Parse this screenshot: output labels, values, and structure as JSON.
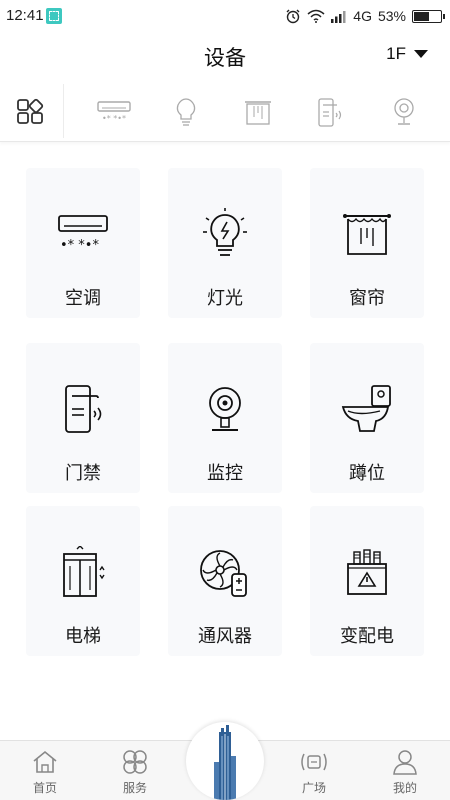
{
  "status_bar": {
    "time": "12:41",
    "network": "4G",
    "battery_text": "53%",
    "battery_level": 0.53,
    "icons": [
      "app-notification-icon",
      "alarm-icon",
      "wifi-icon",
      "signal-icon",
      "battery-icon"
    ]
  },
  "header": {
    "title": "设备",
    "floor": "1F"
  },
  "category_bar": {
    "items": [
      {
        "name": "all-categories-icon",
        "selected": true
      },
      {
        "name": "air-conditioner-icon"
      },
      {
        "name": "light-bulb-icon"
      },
      {
        "name": "curtain-icon"
      },
      {
        "name": "door-access-icon"
      },
      {
        "name": "camera-icon"
      }
    ]
  },
  "devices": [
    {
      "label": "空调",
      "icon": "air-conditioner-icon"
    },
    {
      "label": "灯光",
      "icon": "light-bulb-icon"
    },
    {
      "label": "窗帘",
      "icon": "curtain-icon"
    },
    {
      "label": "门禁",
      "icon": "door-access-icon"
    },
    {
      "label": "监控",
      "icon": "camera-icon"
    },
    {
      "label": "蹲位",
      "icon": "toilet-icon"
    },
    {
      "label": "电梯",
      "icon": "elevator-icon"
    },
    {
      "label": "通风器",
      "icon": "ventilator-icon"
    },
    {
      "label": "变配电",
      "icon": "transformer-icon"
    }
  ],
  "bottom_nav": {
    "items": [
      {
        "label": "首页",
        "icon": "home-icon"
      },
      {
        "label": "服务",
        "icon": "services-icon"
      },
      {
        "label": "广场",
        "icon": "plaza-icon"
      },
      {
        "label": "我的",
        "icon": "profile-icon"
      }
    ],
    "center_icon": "building-icon"
  }
}
